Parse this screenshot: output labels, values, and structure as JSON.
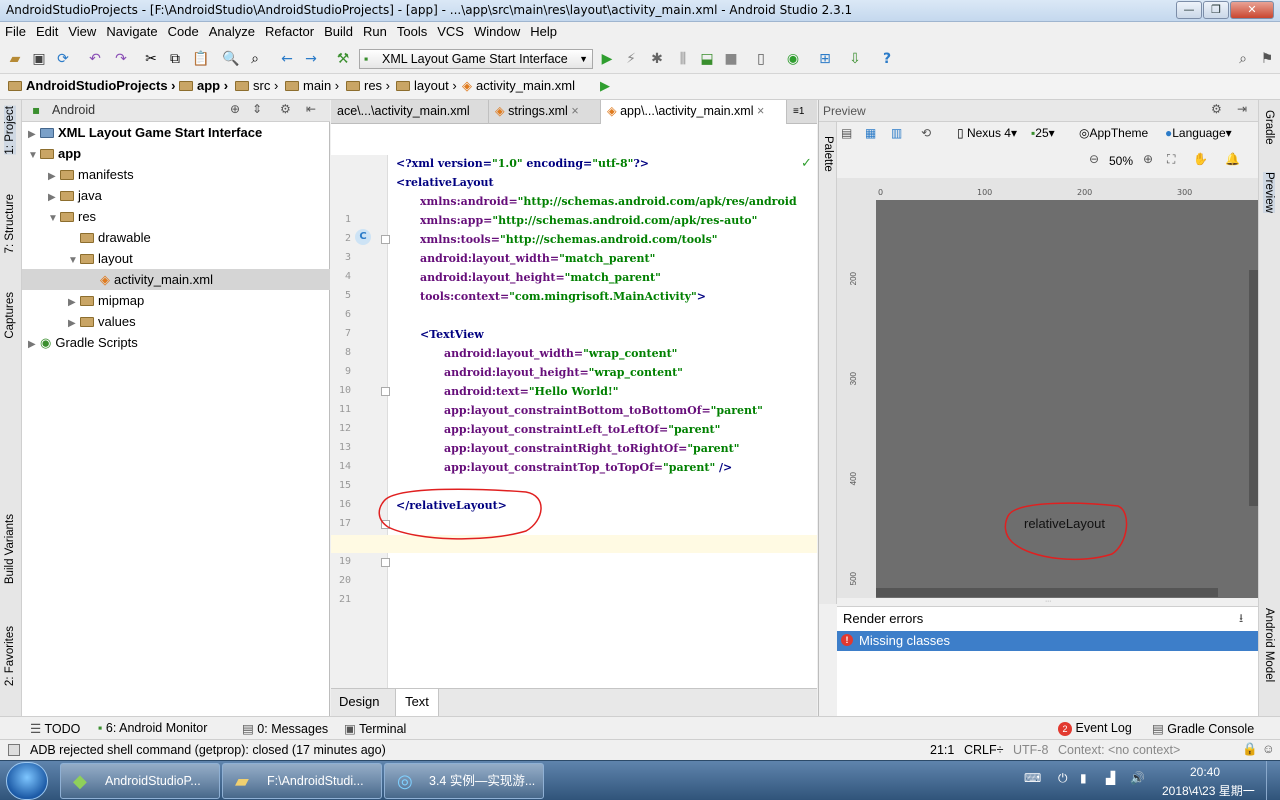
{
  "window": {
    "title": "AndroidStudioProjects - [F:\\AndroidStudio\\AndroidStudioProjects] - [app] - ...\\app\\src\\main\\res\\layout\\activity_main.xml - Android Studio 2.3.1"
  },
  "menu": [
    "File",
    "Edit",
    "View",
    "Navigate",
    "Code",
    "Analyze",
    "Refactor",
    "Build",
    "Run",
    "Tools",
    "VCS",
    "Window",
    "Help"
  ],
  "toolbar": {
    "run_config": "XML Layout Game Start Interface"
  },
  "breadcrumb": [
    "AndroidStudioProjects",
    "app",
    "src",
    "main",
    "res",
    "layout",
    "activity_main.xml"
  ],
  "left_stripe": [
    "1: Project",
    "7: Structure",
    "Captures",
    "Build Variants",
    "2: Favorites"
  ],
  "right_stripe": [
    "Gradle",
    "Preview",
    "Android Model"
  ],
  "project": {
    "view_mode": "Android",
    "tree": [
      {
        "label": "XML Layout Game Start Interface",
        "depth": 0,
        "arrow": "▶",
        "bold": true,
        "icon": "module-icon"
      },
      {
        "label": "app",
        "depth": 0,
        "arrow": "▼",
        "bold": true,
        "icon": "folder-icon"
      },
      {
        "label": "manifests",
        "depth": 1,
        "arrow": "▶",
        "icon": "folder-icon"
      },
      {
        "label": "java",
        "depth": 1,
        "arrow": "▶",
        "icon": "folder-icon"
      },
      {
        "label": "res",
        "depth": 1,
        "arrow": "▼",
        "icon": "folder-icon"
      },
      {
        "label": "drawable",
        "depth": 2,
        "arrow": "",
        "icon": "folder-icon"
      },
      {
        "label": "layout",
        "depth": 2,
        "arrow": "▼",
        "icon": "folder-icon"
      },
      {
        "label": "activity_main.xml",
        "depth": 3,
        "arrow": "",
        "icon": "xml-file-icon",
        "selected": true
      },
      {
        "label": "mipmap",
        "depth": 2,
        "arrow": "▶",
        "icon": "folder-icon"
      },
      {
        "label": "values",
        "depth": 2,
        "arrow": "▶",
        "icon": "folder-icon"
      },
      {
        "label": "Gradle Scripts",
        "depth": 0,
        "arrow": "▶",
        "icon": "gradle-icon"
      }
    ]
  },
  "editor": {
    "tabs": [
      "ace\\...\\activity_main.xml",
      "strings.xml",
      "app\\...\\activity_main.xml"
    ],
    "overflow_tab": "≡1",
    "lines": [
      {
        "n": "1",
        "html": "<span class='tag'>&lt;?xml version=</span><span class='val'>\"1.0\"</span><span class='tag'> encoding=</span><span class='val'>\"utf-8\"</span><span class='tag'>?&gt;</span>",
        "indent": 0
      },
      {
        "n": "2",
        "html": "<span class='tag'>&lt;relativeLayout</span>",
        "indent": 0
      },
      {
        "n": "3",
        "html": "<span class='attr'>xmlns:android=</span><span class='val'>\"http://schemas.android.com/apk/res/android</span>",
        "indent": 1
      },
      {
        "n": "4",
        "html": "<span class='attr'>xmlns:app=</span><span class='val'>\"http://schemas.android.com/apk/res-auto\"</span>",
        "indent": 1
      },
      {
        "n": "5",
        "html": "<span class='attr'>xmlns:tools=</span><span class='val'>\"http://schemas.android.com/tools\"</span>",
        "indent": 1
      },
      {
        "n": "6",
        "html": "<span class='attr'>android:layout_width=</span><span class='val'>\"match_parent\"</span>",
        "indent": 1
      },
      {
        "n": "7",
        "html": "<span class='attr'>android:layout_height=</span><span class='val'>\"match_parent\"</span>",
        "indent": 1
      },
      {
        "n": "8",
        "html": "<span class='attr'>tools:context=</span><span class='val'>\"com.mingrisoft.MainActivity\"</span><span class='tag'>&gt;</span>",
        "indent": 1
      },
      {
        "n": "9",
        "html": "",
        "indent": 0
      },
      {
        "n": "10",
        "html": "<span class='tag'>&lt;TextView</span>",
        "indent": 1
      },
      {
        "n": "11",
        "html": "<span class='attr'>android:layout_width=</span><span class='val'>\"wrap_content\"</span>",
        "indent": 2
      },
      {
        "n": "12",
        "html": "<span class='attr'>android:layout_height=</span><span class='val'>\"wrap_content\"</span>",
        "indent": 2
      },
      {
        "n": "13",
        "html": "<span class='attr'>android:text=</span><span class='val'>\"Hello World!\"</span>",
        "indent": 2
      },
      {
        "n": "14",
        "html": "<span class='attr'>app:layout_constraintBottom_toBottomOf=</span><span class='val'>\"parent\"</span>",
        "indent": 2
      },
      {
        "n": "15",
        "html": "<span class='attr'>app:layout_constraintLeft_toLeftOf=</span><span class='val'>\"parent\"</span>",
        "indent": 2
      },
      {
        "n": "16",
        "html": "<span class='attr'>app:layout_constraintRight_toRightOf=</span><span class='val'>\"parent\"</span>",
        "indent": 2
      },
      {
        "n": "17",
        "html": "<span class='attr'>app:layout_constraintTop_toTopOf=</span><span class='val'>\"parent\"</span><span class='tag'> /&gt;</span>",
        "indent": 2
      },
      {
        "n": "18",
        "html": "",
        "indent": 0
      },
      {
        "n": "19",
        "html": "<span class='tag'>&lt;/relativeLayout&gt;</span>",
        "indent": 0
      },
      {
        "n": "20",
        "html": "",
        "indent": 0
      },
      {
        "n": "21",
        "html": "",
        "indent": 0
      }
    ],
    "bottom_tabs": [
      "Design",
      "Text"
    ]
  },
  "preview": {
    "title": "Preview",
    "palette_label": "Palette",
    "device": "Nexus 4",
    "api": "25",
    "theme": "AppTheme",
    "language": "Language",
    "zoom": "50%",
    "ruler_h": [
      "0",
      "100",
      "200",
      "300"
    ],
    "ruler_v": [
      "200",
      "300",
      "400",
      "500"
    ],
    "canvas_label": "relativeLayout",
    "render_errors_title": "Render errors",
    "error_item": "Missing classes"
  },
  "tool_windows": {
    "left": [
      "TODO",
      "6: Android Monitor",
      "0: Messages",
      "Terminal"
    ],
    "right": [
      "Event Log",
      "Gradle Console"
    ],
    "event_badge": "2"
  },
  "status": {
    "message": "ADB rejected shell command (getprop): closed (17 minutes ago)",
    "position": "21:1",
    "line_sep": "CRLF÷",
    "encoding": "UTF-8",
    "context": "Context: <no context>"
  },
  "taskbar": {
    "items": [
      "AndroidStudioP...",
      "F:\\AndroidStudi...",
      "3.4 实例—实现游..."
    ],
    "time": "20:40",
    "date": "2018\\4\\23 星期一"
  },
  "colors": {
    "selection": "#3d7ec9",
    "error": "#e2392f",
    "canvas": "#6e6e6e"
  }
}
